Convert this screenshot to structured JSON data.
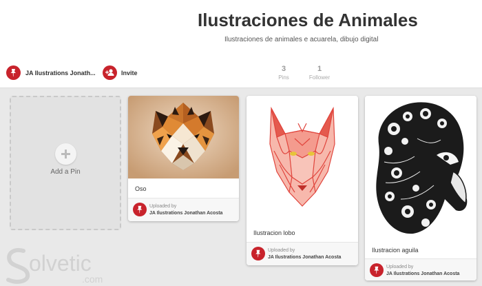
{
  "board": {
    "title": "Ilustraciones de Animales",
    "description": "Ilustraciones de animales e acuarela, dibujo digital",
    "owner": "JA Ilustrations Jonath...",
    "invite_label": "Invite",
    "stats": [
      {
        "value": "3",
        "label": "Pins"
      },
      {
        "value": "1",
        "label": "Follower"
      }
    ]
  },
  "add_pin": {
    "label": "Add a Pin"
  },
  "pins": [
    {
      "description": "Oso",
      "uploaded_label": "Uploaded by",
      "uploader": "JA Ilustrations Jonathan Acosta"
    },
    {
      "description": "Ilustracion lobo",
      "uploaded_label": "Uploaded by",
      "uploader": "JA Ilustrations Jonathan Acosta"
    },
    {
      "description": "Ilustracion aguila",
      "uploaded_label": "Uploaded by",
      "uploader": "JA Ilustrations Jonathan Acosta"
    }
  ],
  "watermark": {
    "text": "olvetic",
    "suffix": ".com"
  },
  "colors": {
    "brand_red": "#c8232c",
    "background": "#e9e9e9"
  }
}
